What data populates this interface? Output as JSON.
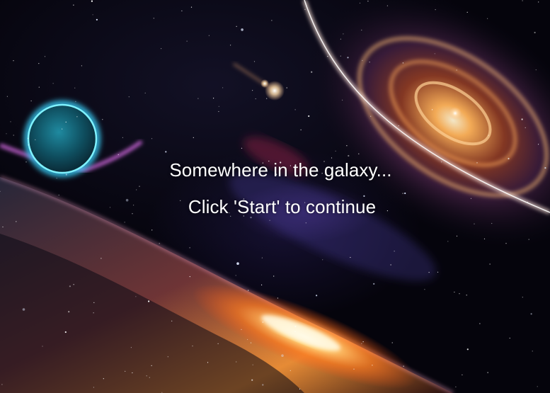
{
  "intro": {
    "line1": "Somewhere in the galaxy...",
    "line2": "Click 'Start' to continue"
  },
  "colors": {
    "space": "#05040c",
    "text": "#ffffff",
    "planet_glow": "#39d4ff",
    "galaxy_core": "#ffb35a",
    "horizon_flare": "#ffd27a"
  }
}
